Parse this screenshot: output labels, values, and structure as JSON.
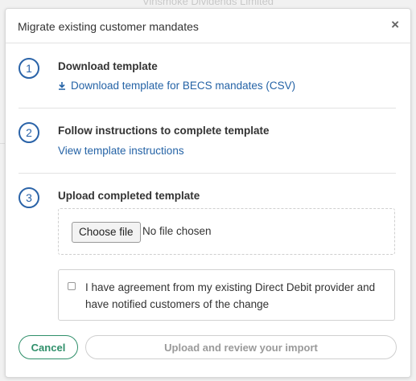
{
  "backdrop": {
    "title": "Vinsmoke Dividends Limited"
  },
  "modal": {
    "title": "Migrate existing customer mandates",
    "close_label": "×"
  },
  "steps": [
    {
      "number": "1",
      "heading": "Download template",
      "link_label": "Download template for BECS mandates (CSV)",
      "link_icon": "download-icon"
    },
    {
      "number": "2",
      "heading": "Follow instructions to complete template",
      "link_label": "View template instructions"
    },
    {
      "number": "3",
      "heading": "Upload completed template",
      "file_input": {
        "button_label": "Choose file",
        "status": "No file chosen"
      },
      "agreement": {
        "checked": false,
        "label": "I have agreement from my existing Direct Debit provider and have notified customers of the change"
      }
    }
  ],
  "footer": {
    "cancel_label": "Cancel",
    "upload_label": "Upload and review your import"
  },
  "colors": {
    "accent_blue": "#2a63a8",
    "link_blue": "#2563a6",
    "cancel_green": "#2f8f6a",
    "disabled_gray": "#9a9a9a"
  }
}
